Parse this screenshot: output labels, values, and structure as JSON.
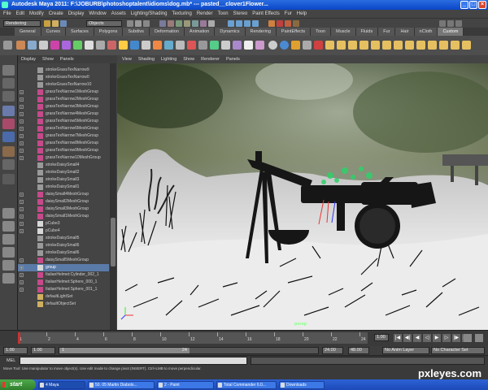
{
  "window": {
    "title": "Autodesk Maya 2011: F:\\JOBURB\\photoshoptalent\\idioms\\dog.mb*  ---  pasted__clover1Flower..."
  },
  "menus": [
    "File",
    "Edit",
    "Modify",
    "Create",
    "Display",
    "Window",
    "Assets",
    "Lighting/Shading",
    "Texturing",
    "Render",
    "Toon",
    "Stereo",
    "Paint Effects",
    "Fur",
    "Help"
  ],
  "status": {
    "mode": "Rendering",
    "select_mode": "Objects"
  },
  "shelf_tabs": [
    "General",
    "Curves",
    "Surfaces",
    "Polygons",
    "Subdivs",
    "Deformation",
    "Animation",
    "Dynamics",
    "Rendering",
    "PaintEffects",
    "Toon",
    "Muscle",
    "Fluids",
    "Fur",
    "Hair",
    "nCloth",
    "Custom"
  ],
  "shelf_active": "Custom",
  "outliner": {
    "menu": [
      "Display",
      "Show",
      "Panels"
    ],
    "items": [
      {
        "label": "strokeGrassTexNarrow9",
        "type": "stroke",
        "exp": false
      },
      {
        "label": "strokeGrassTexNarrow0",
        "type": "stroke",
        "exp": false
      },
      {
        "label": "strokeGrassTexNarrow10",
        "type": "stroke",
        "exp": false
      },
      {
        "label": "grassTexNarrow1MeshGroup",
        "type": "mesh",
        "exp": true
      },
      {
        "label": "grassTexNarrow2MeshGroup",
        "type": "mesh",
        "exp": true
      },
      {
        "label": "grassTexNarrow3MeshGroup",
        "type": "mesh",
        "exp": true
      },
      {
        "label": "grassTexNarrow4MeshGroup",
        "type": "mesh",
        "exp": true
      },
      {
        "label": "grassTexNarrow5MeshGroup",
        "type": "mesh",
        "exp": true
      },
      {
        "label": "grassTexNarrow6MeshGroup",
        "type": "mesh",
        "exp": true
      },
      {
        "label": "grassTexNarrow7MeshGroup",
        "type": "mesh",
        "exp": true
      },
      {
        "label": "grassTexNarrow8MeshGroup",
        "type": "mesh",
        "exp": true
      },
      {
        "label": "grassTexNarrow9MeshGroup",
        "type": "mesh",
        "exp": true
      },
      {
        "label": "grassTexNarrow10MeshGroup",
        "type": "mesh",
        "exp": true
      },
      {
        "label": "strokeDaisySmall4",
        "type": "stroke",
        "exp": false
      },
      {
        "label": "strokeDaisySmall2",
        "type": "stroke",
        "exp": false
      },
      {
        "label": "strokeDaisySmall3",
        "type": "stroke",
        "exp": false
      },
      {
        "label": "strokeDaisySmall1",
        "type": "stroke",
        "exp": false
      },
      {
        "label": "daisySmall4MeshGroup",
        "type": "mesh",
        "exp": true
      },
      {
        "label": "daisySmall2MeshGroup",
        "type": "mesh",
        "exp": true
      },
      {
        "label": "daisySmall3MeshGroup",
        "type": "mesh",
        "exp": true
      },
      {
        "label": "daisySmall1MeshGroup",
        "type": "mesh",
        "exp": true
      },
      {
        "label": "pCube3",
        "type": "cube",
        "exp": true
      },
      {
        "label": "pCube4",
        "type": "cube",
        "exp": true
      },
      {
        "label": "strokeDaisySmall5",
        "type": "stroke",
        "exp": false
      },
      {
        "label": "strokeDaisySmall6",
        "type": "stroke",
        "exp": false
      },
      {
        "label": "strokeDaisySmall6",
        "type": "stroke",
        "exp": false
      },
      {
        "label": "daisySmall5MeshGroup",
        "type": "mesh",
        "exp": true
      },
      {
        "label": "group",
        "type": "group",
        "exp": true,
        "hl": true
      },
      {
        "label": "ItalianHelmet:Cylinder_002_1",
        "type": "mesh",
        "exp": true
      },
      {
        "label": "ItalianHelmet:Sphere_000_1",
        "type": "mesh",
        "exp": true
      },
      {
        "label": "ItalianHelmet:Sphere_001_1",
        "type": "mesh",
        "exp": true
      },
      {
        "label": "defaultLightSet",
        "type": "set",
        "exp": false
      },
      {
        "label": "defaultObjectSet",
        "type": "set",
        "exp": false
      }
    ]
  },
  "viewport": {
    "menu": [
      "View",
      "Shading",
      "Lighting",
      "Show",
      "Renderer",
      "Panels"
    ],
    "camera": "persp"
  },
  "timeslider": {
    "ticks": [
      "1",
      "2",
      "4",
      "6",
      "8",
      "10",
      "12",
      "14",
      "16",
      "18",
      "20",
      "22",
      "24"
    ],
    "current": "1.00"
  },
  "range": {
    "start": "1.00",
    "start2": "1.00",
    "range_start": "1",
    "range_end": "24",
    "end": "24.00",
    "end2": "48.00",
    "anim_layer": "No Anim Layer",
    "character_set": "No Character Set"
  },
  "mel": {
    "label": "MEL"
  },
  "help": "Move Tool: Use manipulator to move object(s). Use edit mode to change pivot (INSERT). Ctrl+LMB to move perpendicular.",
  "taskbar": {
    "start": "start",
    "items": [
      "4 Maya",
      "50. 05 Martin Diabolo...",
      "2 - Paint",
      "Total Commander 6.0...",
      "Downloads"
    ]
  },
  "watermark": "pxleyes.com",
  "colors": {
    "highlight": "#5a7ba8",
    "ground": "#e8e8e8"
  }
}
